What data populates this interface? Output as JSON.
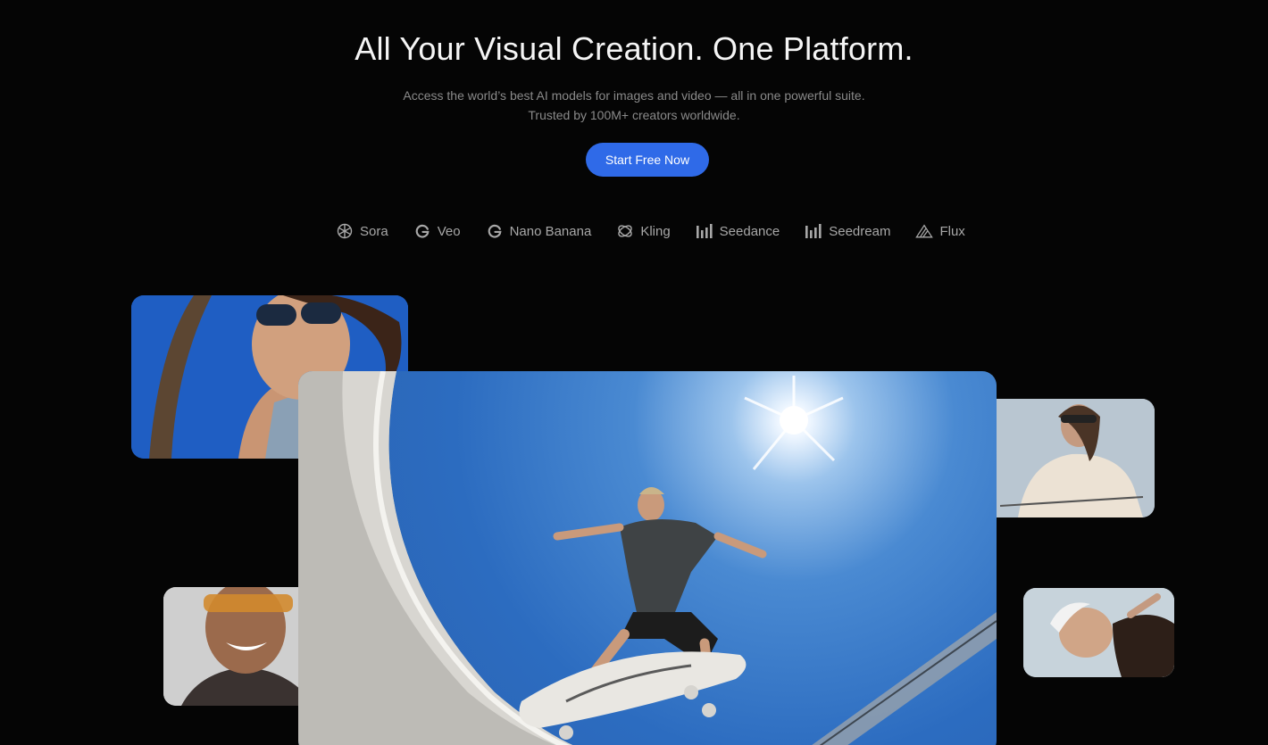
{
  "hero": {
    "title": "All Your Visual Creation. One Platform.",
    "subtitle_line1": "Access the world’s best AI models for images and video — all in one powerful suite.",
    "subtitle_line2": "Trusted by 100M+ creators worldwide.",
    "cta_label": "Start Free Now"
  },
  "models": [
    {
      "label": "Sora",
      "icon": "openai-knot-icon"
    },
    {
      "label": "Veo",
      "icon": "google-g-icon"
    },
    {
      "label": "Nano Banana",
      "icon": "google-g-icon"
    },
    {
      "label": "Kling",
      "icon": "kling-swirl-icon"
    },
    {
      "label": "Seedance",
      "icon": "bar-chart-icon"
    },
    {
      "label": "Seedream",
      "icon": "bar-chart-icon"
    },
    {
      "label": "Flux",
      "icon": "triangle-icon"
    }
  ],
  "colors": {
    "background": "#050505",
    "accent": "#2f6ae8",
    "muted_text": "#8a8a8a",
    "model_text": "#a8a8a8"
  }
}
